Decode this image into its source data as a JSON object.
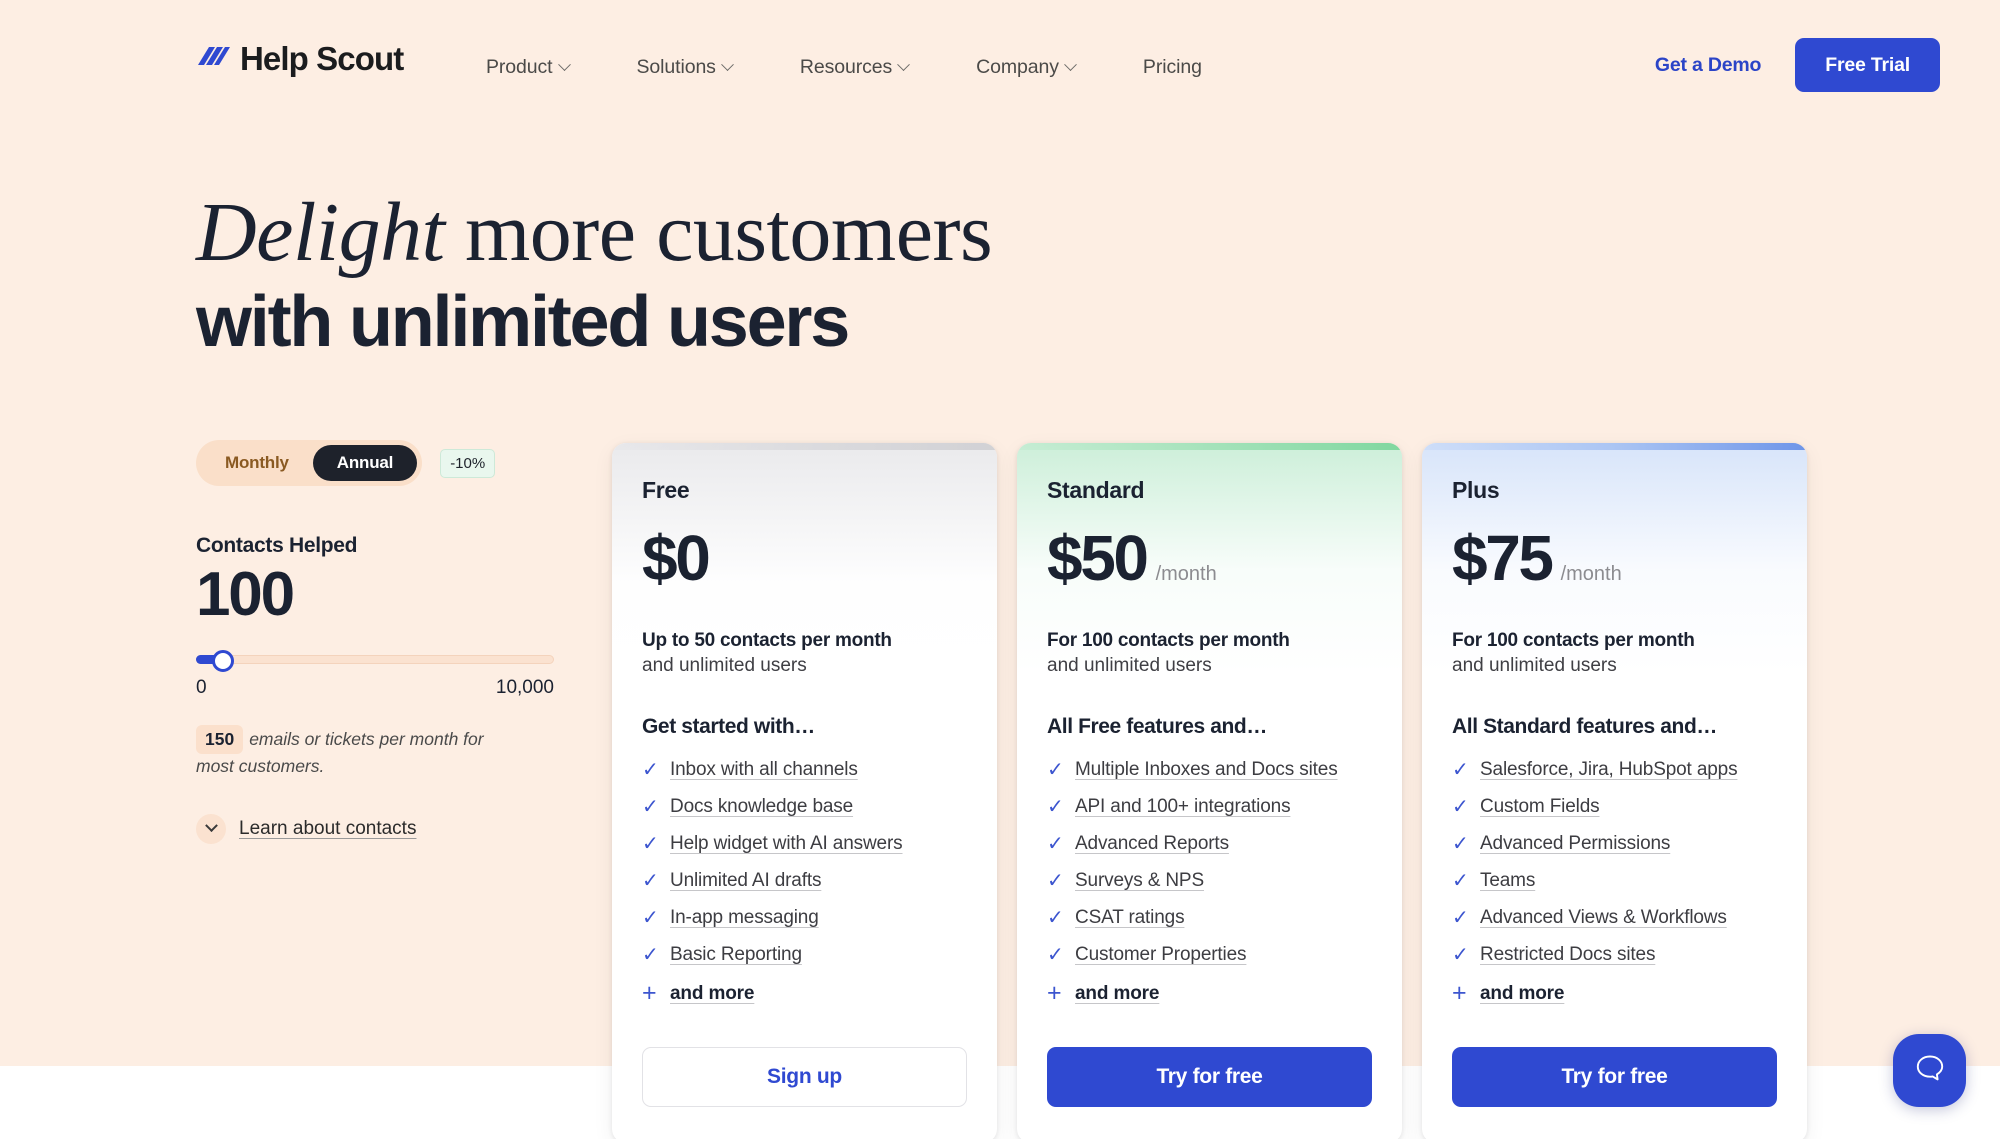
{
  "brand": {
    "name": "Help Scout",
    "logo_icon": "helpscout-logo-icon",
    "accent_blue": "#2f49d1",
    "hero_background": "#fdeee3",
    "ink": "#1b2231"
  },
  "header": {
    "nav_items": [
      {
        "label": "Product",
        "has_dropdown": true
      },
      {
        "label": "Solutions",
        "has_dropdown": true
      },
      {
        "label": "Resources",
        "has_dropdown": true
      },
      {
        "label": "Company",
        "has_dropdown": true
      },
      {
        "label": "Pricing",
        "has_dropdown": false
      }
    ],
    "demo_link": "Get a Demo",
    "trial_button": "Free Trial"
  },
  "hero": {
    "headline_italic": "Delight",
    "headline_rest": " more customers",
    "headline_line2": "with unlimited users"
  },
  "calculator": {
    "billing_monthly": "Monthly",
    "billing_annual": "Annual",
    "billing_selected": "Annual",
    "discount_badge": "-10%",
    "slider_label": "Contacts Helped",
    "slider_value": "100",
    "slider_min_label": "0",
    "slider_max_label": "10,000",
    "slider_min": 0,
    "slider_max": 10000,
    "slider_current": 100,
    "emails_count": "150",
    "emails_note": "emails or tickets per month for most customers.",
    "learn_link": "Learn about contacts",
    "learn_icon": "chevron-down-icon"
  },
  "plans": [
    {
      "id": "free",
      "name": "Free",
      "price": "$0",
      "period": "",
      "sub_bold": "Up to 50 contacts per month",
      "sub_normal": "and unlimited users",
      "features_title": "Get started with…",
      "features": [
        "Inbox with all channels",
        "Docs knowledge base",
        "Help widget with AI answers",
        "Unlimited AI drafts",
        "In-app messaging",
        "Basic Reporting"
      ],
      "and_more": "and more",
      "cta": "Sign up",
      "cta_style": "outline",
      "accent_color": "#c9c9cc"
    },
    {
      "id": "standard",
      "name": "Standard",
      "price": "$50",
      "period": "/month",
      "sub_bold": "For 100 contacts per month",
      "sub_normal": "and unlimited users",
      "features_title": "All Free features and…",
      "features": [
        "Multiple Inboxes and Docs sites",
        "API and 100+ integrations",
        "Advanced Reports",
        "Surveys & NPS",
        "CSAT ratings",
        "Customer Properties"
      ],
      "and_more": "and more",
      "cta": "Try for free",
      "cta_style": "solid",
      "accent_color": "#73d496"
    },
    {
      "id": "plus",
      "name": "Plus",
      "price": "$75",
      "period": "/month",
      "sub_bold": "For 100 contacts per month",
      "sub_normal": "and unlimited users",
      "features_title": "All Standard features and…",
      "features": [
        "Salesforce, Jira, HubSpot apps",
        "Custom Fields",
        "Advanced Permissions",
        "Teams",
        "Advanced Views & Workflows",
        "Restricted Docs sites"
      ],
      "and_more": "and more",
      "cta": "Try for free",
      "cta_style": "solid",
      "accent_color": "#3f6fe0"
    }
  ],
  "chat_widget": {
    "icon": "chat-bubble-icon"
  }
}
